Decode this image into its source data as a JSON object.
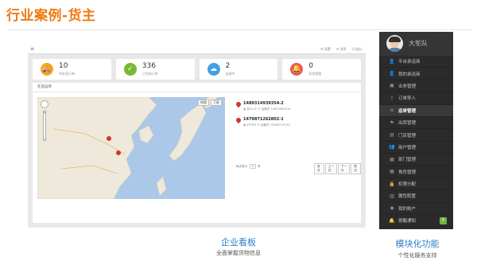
{
  "slide": {
    "title": "行业案例-货主"
  },
  "dashboard": {
    "menu_toggle": "≡",
    "top_links": [
      "⚙ 设置",
      "✉ 消息",
      "⏻ 退出"
    ],
    "stats": [
      {
        "value": "10",
        "label": "待处理订单",
        "icon": "truck-icon",
        "color": "#f5a623",
        "glyph": "🚚"
      },
      {
        "value": "336",
        "label": "已完成订单",
        "icon": "check-icon",
        "color": "#7ab834",
        "glyph": "✓"
      },
      {
        "value": "2",
        "label": "运输中",
        "icon": "cloud-icon",
        "color": "#3fa2e0",
        "glyph": "☁"
      },
      {
        "value": "0",
        "label": "异常提醒",
        "icon": "bell-icon",
        "color": "#e85a5a",
        "glyph": "🔔"
      }
    ],
    "panel_title": "在途运单",
    "map_buttons": [
      "地图",
      "卫星"
    ],
    "map_zoom": {
      "plus": "+",
      "minus": "−"
    },
    "orders": [
      {
        "id": "1489314939354-2",
        "meta": "◉ 浙G12F  ✆ 运输员 13819489126"
      },
      {
        "id": "1479871262802-1",
        "meta": "◉ 沪F5RT  ✆ 运输员 15600220187"
      }
    ],
    "pager": {
      "prefix": "每页显示",
      "size": "3",
      "suffix": "条",
      "buttons": [
        "首页",
        "上一页",
        "下一页",
        "尾页"
      ]
    }
  },
  "side_menu": {
    "user_name": "大鸵队",
    "items": [
      {
        "label": "平台承运商",
        "icon": "user-icon",
        "glyph": "👤"
      },
      {
        "label": "我的承运商",
        "icon": "user-icon",
        "glyph": "👤"
      },
      {
        "label": "业务管理",
        "icon": "briefcase-icon",
        "glyph": "▣"
      },
      {
        "label": "订单导入",
        "icon": "import-icon",
        "glyph": "⇪"
      },
      {
        "label": "运单管理",
        "icon": "list-icon",
        "glyph": "≡",
        "active": true
      },
      {
        "label": "出库管理",
        "icon": "flag-icon",
        "glyph": "⚑"
      },
      {
        "label": "门店管理",
        "icon": "store-icon",
        "glyph": "▤"
      },
      {
        "label": "用户管理",
        "icon": "users-icon",
        "glyph": "👥"
      },
      {
        "label": "部门管理",
        "icon": "grid-icon",
        "glyph": "▦"
      },
      {
        "label": "角色管理",
        "icon": "grid-icon",
        "glyph": "▦"
      },
      {
        "label": "权限分配",
        "icon": "lock-icon",
        "glyph": "🔒"
      },
      {
        "label": "属性配置",
        "icon": "settings-icon",
        "glyph": "▥"
      },
      {
        "label": "我的账户",
        "icon": "account-icon",
        "glyph": "◉"
      },
      {
        "label": "提醒通知",
        "icon": "bell-icon",
        "glyph": "🔔",
        "badge": "0"
      }
    ]
  },
  "captions": {
    "left_title": "企业看板",
    "left_sub": "全面掌握货物信息",
    "right_title": "模块化功能",
    "right_sub": "个性化服务支持"
  }
}
